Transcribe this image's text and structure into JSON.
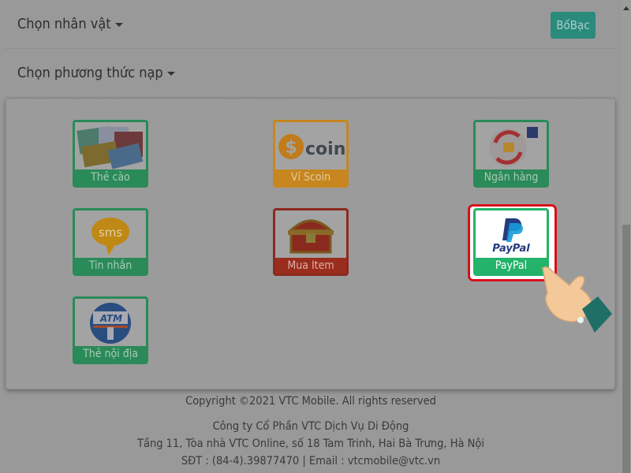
{
  "header": {
    "character_label": "Chọn nhân vật",
    "method_label": "Chọn phương thức nạp",
    "account_button": "BốBạc"
  },
  "methods": [
    {
      "label": "Thẻ cào",
      "icon": "scratch-card-icon",
      "color": "#2a8a58"
    },
    {
      "label": "Ví Scoin",
      "icon": "scoin-icon",
      "logo_text": "coin",
      "color": "#c7861f"
    },
    {
      "label": "Ngân hàng",
      "icon": "bank-icon",
      "color": "#2a8a58"
    },
    {
      "label": "Tin nhắn",
      "icon": "sms-icon",
      "logo_text": "sms",
      "color": "#2a8a58"
    },
    {
      "label": "Mua Item",
      "icon": "treasure-chest-icon",
      "color": "#9a2d1e"
    },
    {
      "label": "PayPal",
      "icon": "paypal-icon",
      "logo_text": "PayPal",
      "color": "#23b36a",
      "selected": true
    },
    {
      "label": "Thẻ nội địa",
      "icon": "atm-icon",
      "logo_text": "ATM",
      "color": "#2a8a58"
    }
  ],
  "footer": {
    "copyright": "Copyright ©2021 VTC Mobile. All rights reserved",
    "company": "Công ty Cổ Phần VTC Dịch Vụ Di Động",
    "address": "Tầng 11, Tòa nhà VTC Online, số 18 Tam Trinh, Hai Bà Trưng, Hà Nội",
    "contact": "SĐT : (84-4).39877470 | Email : vtcmobile@vtc.vn"
  },
  "highlight_color": "#d8101a"
}
